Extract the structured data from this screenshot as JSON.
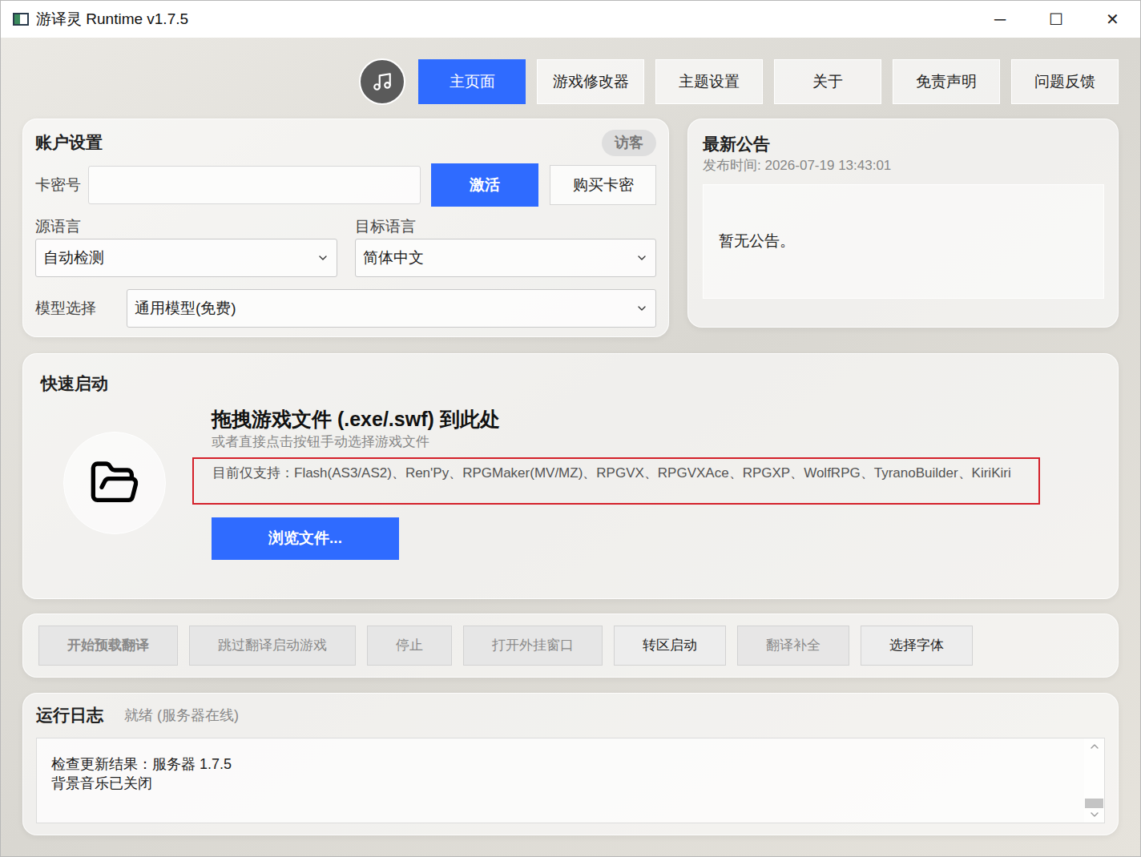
{
  "window": {
    "title": "游译灵 Runtime v1.7.5",
    "controls": [
      "─",
      "☐",
      "✕"
    ]
  },
  "tabs": [
    {
      "label": "主页面",
      "selected": true
    },
    {
      "label": "游戏修改器",
      "selected": false
    },
    {
      "label": "主题设置",
      "selected": false
    },
    {
      "label": "关于",
      "selected": false
    },
    {
      "label": "免责声明",
      "selected": false
    },
    {
      "label": "问题反馈",
      "selected": false
    }
  ],
  "account": {
    "title": "账户设置",
    "badge": "访客",
    "card_label": "卡密号",
    "card_value": "",
    "activate_button": "激活",
    "buy_button": "购买卡密",
    "source_label": "源语言",
    "source_value": "自动检测",
    "target_label": "目标语言",
    "target_value": "简体中文",
    "model_label": "模型选择",
    "model_value": "通用模型(免费)"
  },
  "announcement": {
    "title": "最新公告",
    "published": "发布时间: 2026-07-19 13:43:01",
    "body": "暂无公告。"
  },
  "quick_start": {
    "title": "快速启动",
    "drop_heading": "拖拽游戏文件 (.exe/.swf) 到此处",
    "drop_hint": "或者直接点击按钮手动选择游戏文件",
    "supported": "目前仅支持：Flash(AS3/AS2)、Ren'Py、RPGMaker(MV/MZ)、RPGVX、RPGVXAce、RPGXP、WolfRPG、TyranoBuilder、KiriKiri",
    "supported_highlighted": true,
    "browse_button": "浏览文件..."
  },
  "actions": [
    {
      "label": "开始预载翻译",
      "disabled": true
    },
    {
      "label": "跳过翻译启动游戏",
      "disabled": true
    },
    {
      "label": "停止",
      "disabled": true
    },
    {
      "label": "打开外挂窗口",
      "disabled": true
    },
    {
      "label": "转区启动",
      "disabled": false
    },
    {
      "label": "翻译补全",
      "disabled": true
    },
    {
      "label": "选择字体",
      "disabled": false
    }
  ],
  "log": {
    "title": "运行日志",
    "status": "就绪 (服务器在线)",
    "lines": [
      "检查更新结果：服务器 1.7.5",
      "背景音乐已关闭"
    ],
    "scroll_position": 1
  }
}
